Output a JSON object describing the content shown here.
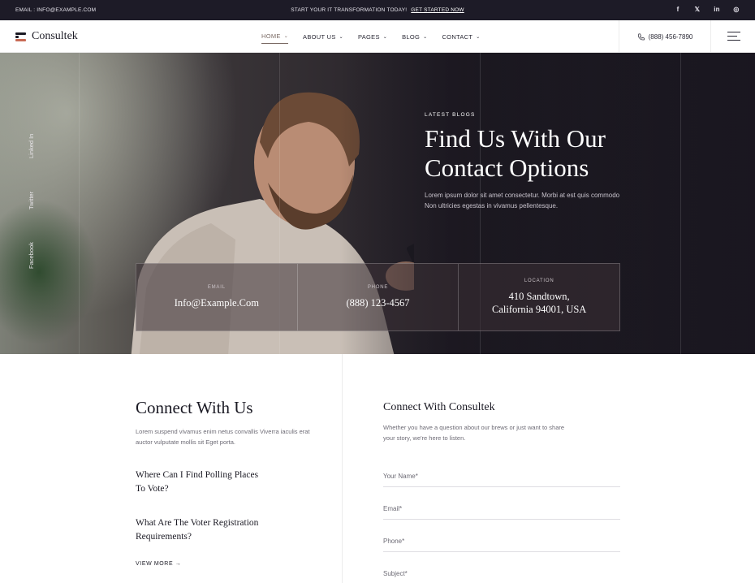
{
  "topbar": {
    "email": "EMAIL : INFO@EXAMPLE.COM",
    "promo_text": "START YOUR IT TRANSFORMATION TODAY!",
    "promo_link": "GET STARTED NOW",
    "social": [
      "f",
      "𝕏",
      "in",
      "◎"
    ]
  },
  "nav": {
    "logo": "Consultek",
    "menu": [
      {
        "label": "HOME"
      },
      {
        "label": "ABOUT US"
      },
      {
        "label": "PAGES"
      },
      {
        "label": "BLOG"
      },
      {
        "label": "CONTACT"
      }
    ],
    "phone": "(888) 456-7890"
  },
  "hero": {
    "side_social": [
      "Linked In",
      "Twitter",
      "Facebook"
    ],
    "eyebrow": "LATEST BLOGS",
    "title_line1": "Find Us With Our",
    "title_line2": "Contact Options",
    "text": "Lorem ipsum dolor sit amet consectetur. Morbi at est quis commodo Non ultricies egestas in vivamus pellentesque.",
    "cards": [
      {
        "label": "EMAIL",
        "value": "Info@Example.Com"
      },
      {
        "label": "PHONE",
        "value": "(888) 123-4567"
      },
      {
        "label": "LOCATION",
        "value_line1": "410 Sandtown,",
        "value_line2": "California 94001, USA"
      }
    ]
  },
  "connect": {
    "title": "Connect With Us",
    "desc": "Lorem suspend vivamus enim netus convallis Viverra iaculis erat auctor vulputate mollis sit Eget porta.",
    "faq1": "Where Can I Find Polling Places To Vote?",
    "faq2": "What Are The Voter Registration Requirements?",
    "view_more": "VIEW MORE →"
  },
  "form": {
    "title": "Connect With Consultek",
    "desc": "Whether you have a question about our brews or just want to share your story, we're here to listen.",
    "fields": [
      "Your Name*",
      "Email*",
      "Phone*",
      "Subject*"
    ]
  }
}
